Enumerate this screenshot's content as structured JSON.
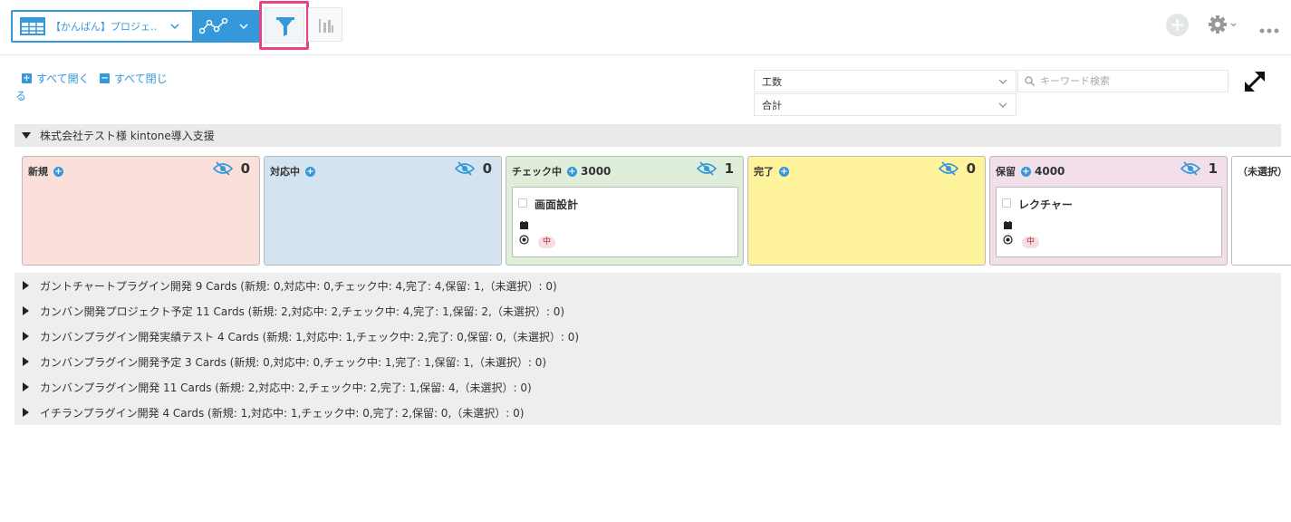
{
  "toolbar": {
    "view_name": "【かんばん】プロジェ…",
    "icons": [
      "table-icon",
      "graph-icon",
      "filter-icon",
      "bar-chart-icon",
      "plus-icon",
      "gear-icon",
      "more-icon"
    ]
  },
  "controls": {
    "open_all": "すべて開く",
    "close_all": "すべて閉じ",
    "close_all_wrap": "る",
    "field_select": "工数",
    "agg_select": "合計",
    "search_placeholder": "キーワード検索"
  },
  "project": {
    "title": "株式会社テスト様 kintone導入支援",
    "columns": [
      {
        "label": "新規",
        "sum": "",
        "count": "0",
        "color": "#fadfdb"
      },
      {
        "label": "対応中",
        "sum": "",
        "count": "0",
        "color": "#d3e4f0"
      },
      {
        "label": "チェック中",
        "sum": "3000",
        "count": "1",
        "color": "#deeeda",
        "card": {
          "title": "画面設計",
          "badge": "中"
        }
      },
      {
        "label": "完了",
        "sum": "",
        "count": "0",
        "color": "#fff49b"
      },
      {
        "label": "保留",
        "sum": "4000",
        "count": "1",
        "color": "#f3dfe9",
        "card": {
          "title": "レクチャー",
          "badge": "中"
        }
      },
      {
        "label": "（未選択）",
        "sum": "",
        "count": "",
        "color": "#ffffff"
      }
    ]
  },
  "collapsed_groups": [
    "ガントチャートプラグイン開発  9 Cards (新規: 0,対応中: 0,チェック中: 4,完了: 4,保留: 1,（未選択）: 0)",
    "カンバン開発プロジェクト予定  11 Cards (新規: 2,対応中: 2,チェック中: 4,完了: 1,保留: 2,（未選択）: 0)",
    "カンバンプラグイン開発実績テスト  4 Cards (新規: 1,対応中: 1,チェック中: 2,完了: 0,保留: 0,（未選択）: 0)",
    "カンバンプラグイン開発予定  3 Cards (新規: 0,対応中: 0,チェック中: 1,完了: 1,保留: 1,（未選択）: 0)",
    "カンバンプラグイン開発  11 Cards (新規: 2,対応中: 2,チェック中: 2,完了: 1,保留: 4,（未選択）: 0)",
    "イチランプラグイン開発  4 Cards (新規: 1,対応中: 1,チェック中: 0,完了: 2,保留: 0,（未選択）: 0)"
  ],
  "colors": {
    "accent": "#3498db",
    "highlight": "#e4448a"
  }
}
